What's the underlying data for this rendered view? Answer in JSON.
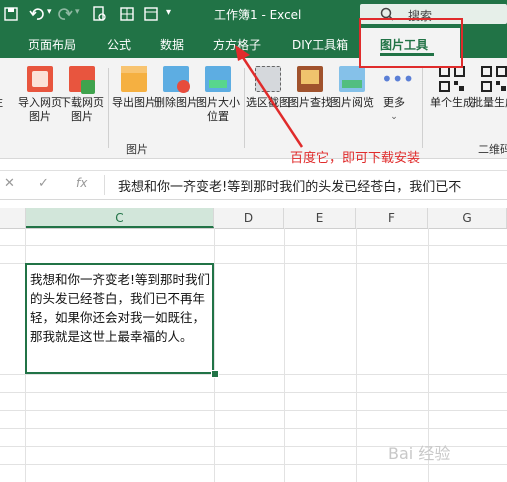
{
  "titlebar": {
    "title": "工作簿1 - Excel",
    "search_label": "搜索"
  },
  "tabs": [
    {
      "label": "页面布局"
    },
    {
      "label": "公式"
    },
    {
      "label": "数据"
    },
    {
      "label": "方方格子"
    },
    {
      "label": "DIY工具箱"
    },
    {
      "label": "图片工具"
    }
  ],
  "ribbon": {
    "edge_labels": [
      "注"
    ],
    "buttons": [
      {
        "label": "导入网页图片",
        "icon": "import-web-image-icon"
      },
      {
        "label": "下载网页图片",
        "icon": "download-web-image-icon"
      },
      {
        "label": "导出图片",
        "icon": "export-image-icon"
      },
      {
        "label": "删除图片",
        "icon": "delete-image-icon"
      },
      {
        "label": "图片大小位置",
        "icon": "image-size-position-icon"
      },
      {
        "label": "选区截图",
        "icon": "selection-screenshot-icon"
      },
      {
        "label": "图片查找",
        "icon": "image-search-icon"
      },
      {
        "label": "图片阅览",
        "icon": "image-preview-icon"
      },
      {
        "label": "更多",
        "icon": "more-icon"
      },
      {
        "label": "单个生成",
        "icon": "qr-single-icon"
      },
      {
        "label": "批量生成",
        "icon": "qr-batch-icon"
      }
    ],
    "group_label": "图片",
    "group2_label": "二维码"
  },
  "annotation": {
    "note": "百度它，即可下载安装",
    "color": "#e02b2b"
  },
  "formula_bar": {
    "text": "我想和你一齐变老!等到那时我们的头发已经苍白，我们已不"
  },
  "grid": {
    "columns": [
      "C",
      "D",
      "E",
      "F",
      "G"
    ],
    "cell_text": "我想和你一齐变老!等到那时我们的头发已经苍白，我们已不再年轻，如果你还会对我一如既往，那我就是这世上最幸福的人。"
  },
  "watermark": "Bai 经验",
  "colors": {
    "excel_green": "#217346",
    "selected_col": "#d2e6da"
  }
}
